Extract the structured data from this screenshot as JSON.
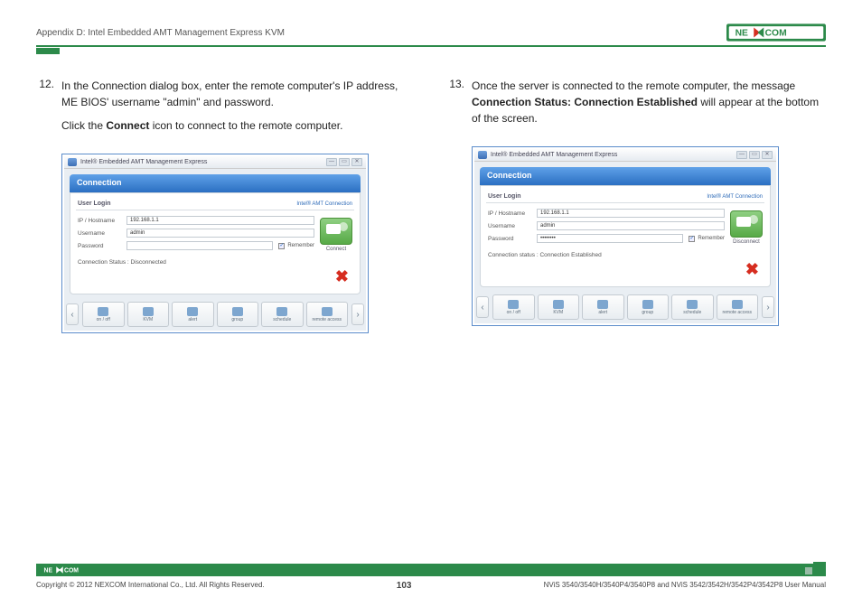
{
  "header": {
    "title": "Appendix D: Intel Embedded AMT Management Express KVM",
    "logo_text": "NEXCOM"
  },
  "steps": {
    "left": {
      "num": "12.",
      "p1a": "In the Connection dialog box, enter the remote computer's IP address, ME BIOS' username \"admin\" and password.",
      "p2a": "Click the ",
      "p2b": "Connect",
      "p2c": " icon to connect to the remote computer."
    },
    "right": {
      "num": "13.",
      "p1a": "Once the server is connected to the remote computer, the message ",
      "p1b": "Connection Status: Connection Established",
      "p1c": " will appear at the bottom of the screen."
    }
  },
  "app": {
    "title": "Intel® Embedded AMT Management Express",
    "section": "Connection",
    "user_login": "User Login",
    "amt_link": "Intel® AMT Connection",
    "labels": {
      "ip": "IP / Hostname",
      "user": "Username",
      "pass": "Password",
      "remember": "Remember"
    },
    "tabs": [
      "on / off",
      "KVM",
      "alert",
      "group",
      "schedule",
      "remote access"
    ]
  },
  "left_instance": {
    "ip": "192.168.1.1",
    "user": "admin",
    "pass": "",
    "connect_label": "Connect",
    "status": "Connection Status : Disconnected"
  },
  "right_instance": {
    "ip": "192.168.1.1",
    "user": "admin",
    "pass": "••••••••",
    "connect_label": "Disconnect",
    "status": "Connection status : Connection Established"
  },
  "footer": {
    "copyright": "Copyright © 2012 NEXCOM International Co., Ltd. All Rights Reserved.",
    "page": "103",
    "manual": "NViS 3540/3540H/3540P4/3540P8 and NViS 3542/3542H/3542P4/3542P8 User Manual"
  }
}
